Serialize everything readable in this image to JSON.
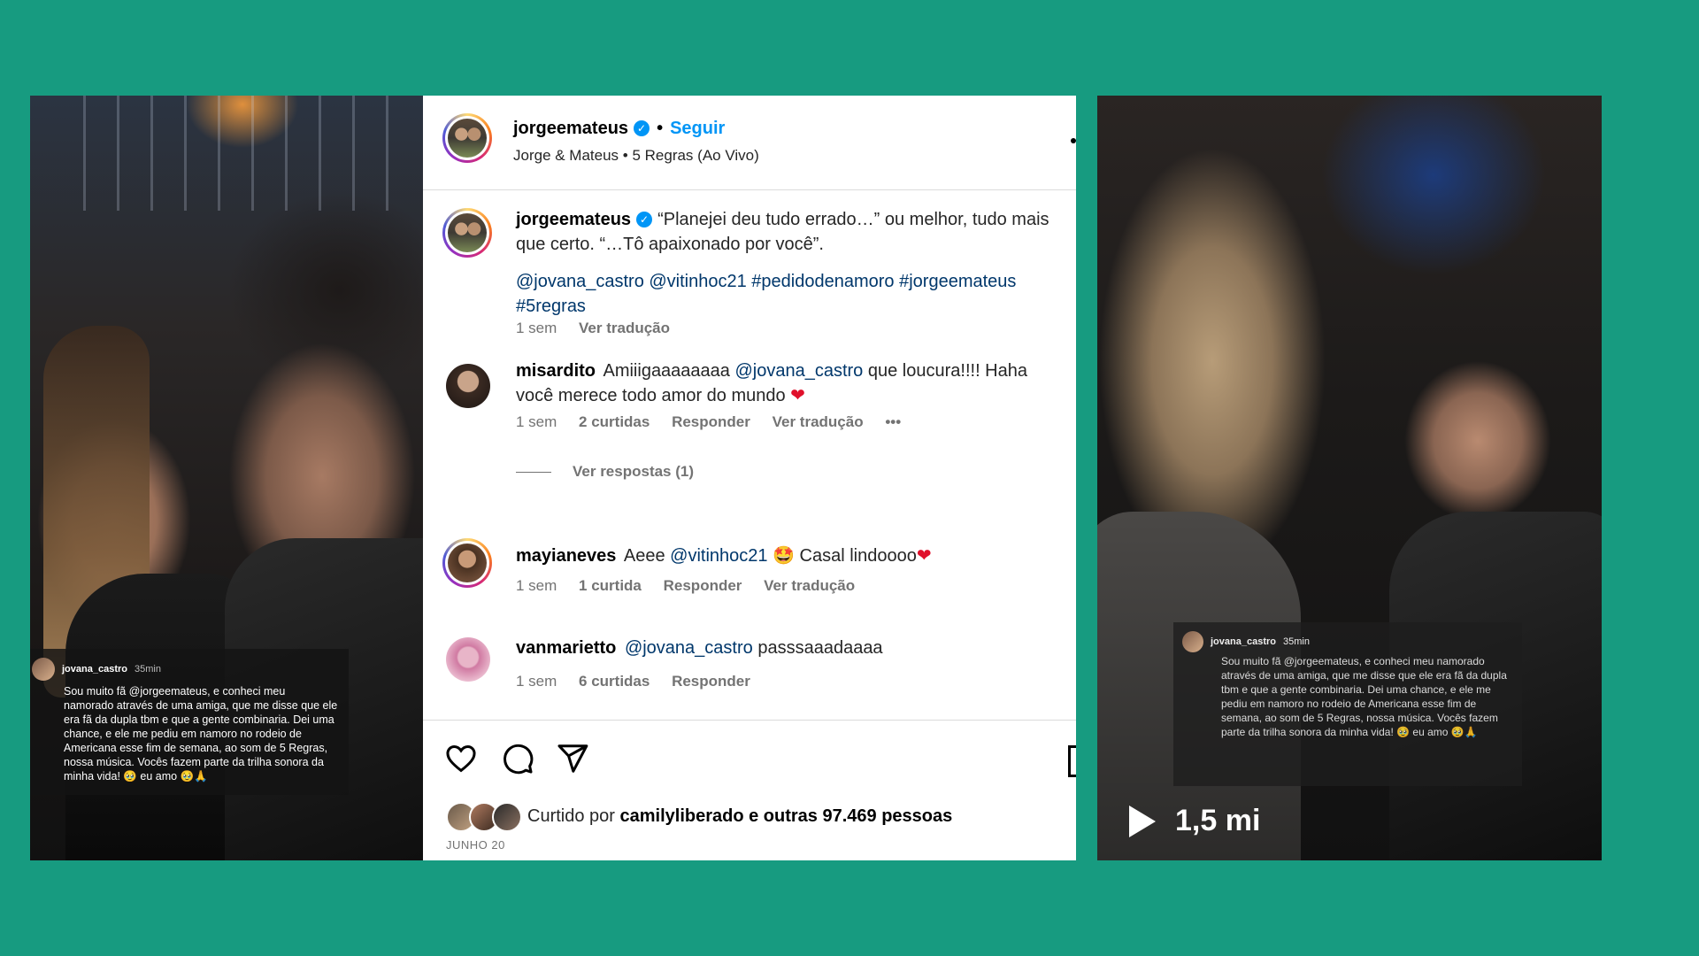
{
  "left_story": {
    "username": "jovana_castro",
    "time": "35min",
    "text": "Sou muito fã @jorgeemateus, e conheci meu namorado através de uma amiga, que me disse que ele era fã da dupla tbm e que a gente combinaria. Dei uma chance, e ele me pediu em namoro no rodeio de Americana esse fim de semana, ao som de 5 Regras, nossa música. Vocês fazem parte da trilha sonora da minha vida! 🥹 eu amo 🥹🙏"
  },
  "post": {
    "header": {
      "username": "jorgeemateus",
      "separator": "•",
      "follow_label": "Seguir",
      "audio": "Jorge & Mateus • 5 Regras (Ao Vivo)"
    },
    "caption": {
      "username": "jorgeemateus",
      "text": "“Planejei deu tudo errado…” ou melhor, tudo mais que certo. “…Tô apaixonado por você”.",
      "tags": "@jovana_castro @vitinhoc21 #pedidodenamoro #jorgeemateus #5regras",
      "time": "1 sem",
      "translate": "Ver tradução"
    },
    "comments": [
      {
        "username": "misardito",
        "text_pre": "Amiiigaaaaaaaa",
        "mention": "@jovana_castro",
        "text_post": "que loucura!!!! Haha você merece todo amor do mundo",
        "emoji": "❤",
        "time": "1 sem",
        "likes": "2 curtidas",
        "reply": "Responder",
        "translate": "Ver tradução",
        "more": "•••",
        "view_replies": "Ver respostas (1)"
      },
      {
        "username": "mayianeves",
        "text_pre": "Aeee",
        "mention": "@vitinhoc21",
        "text_post": "🤩 Casal lindoooo",
        "emoji": "❤",
        "time": "1 sem",
        "likes": "1 curtida",
        "reply": "Responder",
        "translate": "Ver tradução"
      },
      {
        "username": "vanmarietto",
        "mention": "@jovana_castro",
        "text_post": "passsaaadaaaa",
        "time": "1 sem",
        "likes": "6 curtidas",
        "reply": "Responder"
      }
    ],
    "likes": {
      "prefix": "Curtido por",
      "user": "camilyliberado",
      "suffix": "e outras 97.469 pessoas"
    },
    "date": "JUNHO 20"
  },
  "right_story": {
    "username": "jovana_castro",
    "time": "35min",
    "text": "Sou muito fã @jorgeemateus, e conheci meu namorado através de uma amiga, que me disse que ele era fã da dupla tbm e que a gente combinaria. Dei uma chance, e ele me pediu em namoro no rodeio de Americana esse fim de semana, ao som de 5 Regras, nossa música. Vocês fazem parte da trilha sonora da minha vida! 🥹 eu amo 🥹🙏",
    "views": "1,5 mi"
  },
  "colors": {
    "background": "#179b80",
    "link_blue": "#0095f6",
    "mention": "#00376b",
    "heart": "#e0102b"
  }
}
